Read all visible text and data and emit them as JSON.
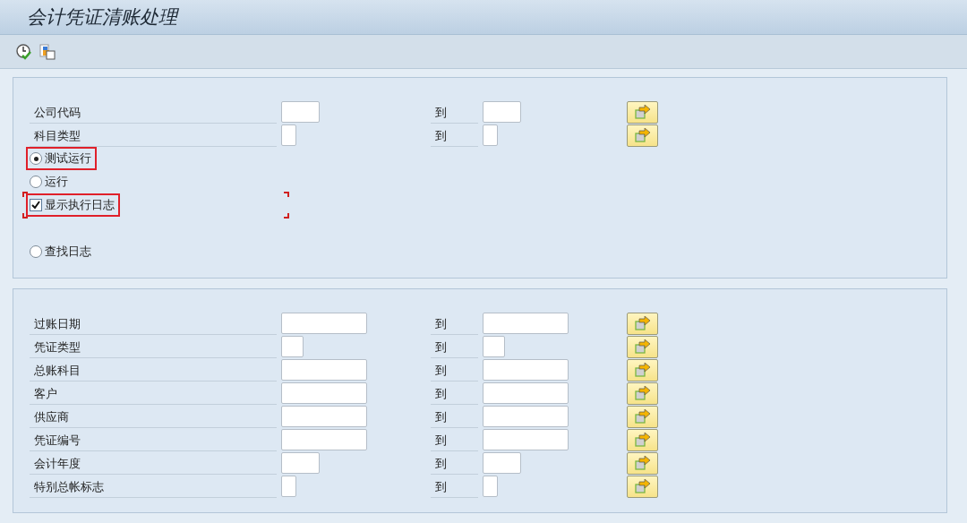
{
  "window": {
    "title": "会计凭证清账处理"
  },
  "toolbar": {
    "buttons": [
      {
        "kind": "execute"
      },
      {
        "kind": "variant"
      }
    ]
  },
  "panels": [
    {
      "ranges": [
        {
          "label": "公司代码",
          "kind": "medium",
          "to": "到"
        },
        {
          "label": "科目类型",
          "kind": "tiny",
          "to": "到"
        }
      ],
      "options": [
        {
          "kind": "radio",
          "label": "测试运行",
          "selected": true,
          "highlighted": true,
          "focused": false
        },
        {
          "kind": "radio",
          "label": "运行",
          "selected": false,
          "highlighted": false,
          "focused": false
        },
        {
          "kind": "checkbox",
          "label": "显示执行日志",
          "checked": true,
          "highlighted": true,
          "focused": true
        },
        {
          "kind": "gap"
        },
        {
          "kind": "radio",
          "label": "查找日志",
          "selected": false,
          "highlighted": false,
          "focused": false
        }
      ]
    },
    {
      "ranges": [
        {
          "label": "过账日期",
          "kind": "long",
          "to": "到"
        },
        {
          "label": "凭证类型",
          "kind": "small",
          "to": "到"
        },
        {
          "label": "总账科目",
          "kind": "long",
          "to": "到"
        },
        {
          "label": "客户",
          "kind": "long",
          "to": "到"
        },
        {
          "label": "供应商",
          "kind": "long",
          "to": "到"
        },
        {
          "label": "凭证编号",
          "kind": "long",
          "to": "到"
        },
        {
          "label": "会计年度",
          "kind": "medium",
          "to": "到"
        },
        {
          "label": "特别总帐标志",
          "kind": "tiny",
          "to": "到"
        }
      ]
    }
  ]
}
